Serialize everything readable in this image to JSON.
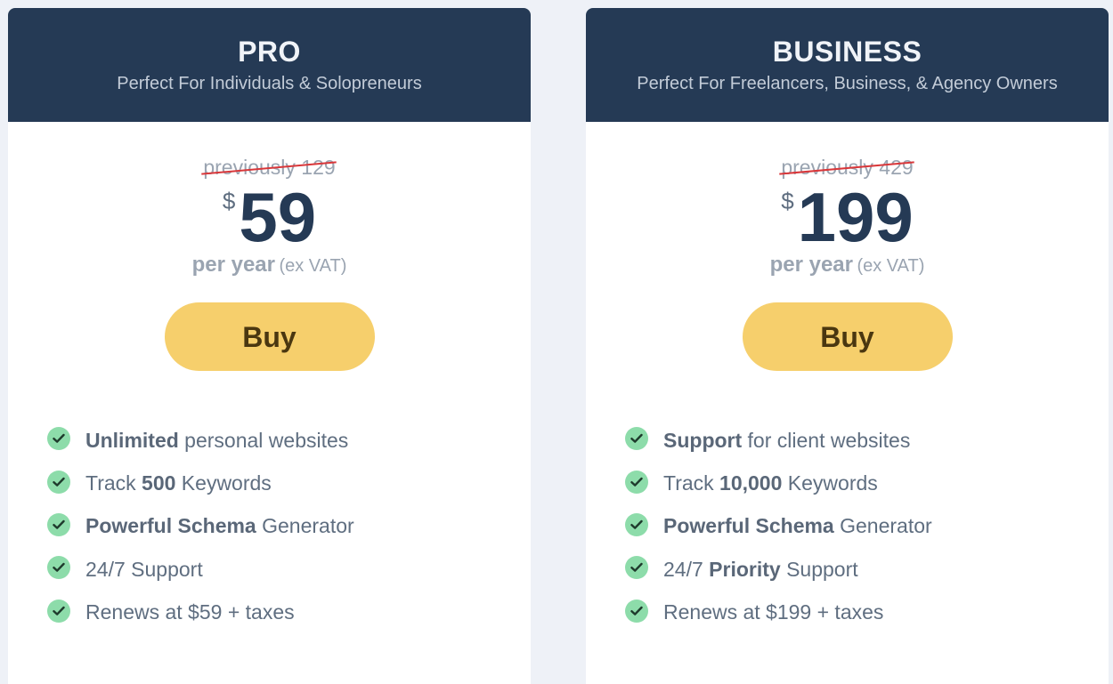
{
  "plans": [
    {
      "name": "PRO",
      "subtitle": "Perfect For Individuals & Solopreneurs",
      "previous_price": "previously 129",
      "currency": "$",
      "price": "59",
      "period": "per year",
      "period_note": "(ex VAT)",
      "buy_label": "Buy",
      "features": [
        {
          "bold": "Unlimited",
          "rest": " personal websites"
        },
        {
          "pre": "Track ",
          "bold": "500",
          "rest": " Keywords"
        },
        {
          "bold": "Powerful Schema",
          "rest": " Generator"
        },
        {
          "rest": "24/7 Support"
        },
        {
          "rest": "Renews at $59 + taxes"
        }
      ]
    },
    {
      "name": "BUSINESS",
      "subtitle": "Perfect For Freelancers, Business, & Agency Owners",
      "previous_price": "previously 429",
      "currency": "$",
      "price": "199",
      "period": "per year",
      "period_note": "(ex VAT)",
      "buy_label": "Buy",
      "features": [
        {
          "bold": "Support",
          "rest": " for client websites"
        },
        {
          "pre": "Track ",
          "bold": "10,000",
          "rest": " Keywords"
        },
        {
          "bold": "Powerful Schema",
          "rest": " Generator"
        },
        {
          "pre": "24/7 ",
          "bold": "Priority",
          "rest": " Support"
        },
        {
          "rest": "Renews at $199 + taxes"
        }
      ]
    }
  ],
  "icons": {
    "feature_check": "check-circle-icon"
  },
  "colors": {
    "header_bg": "#253a55",
    "buy_button": "#f6cf6c",
    "check": "#8ddcaa",
    "strike": "#d9373a",
    "page_bg": "#eef1f7"
  }
}
